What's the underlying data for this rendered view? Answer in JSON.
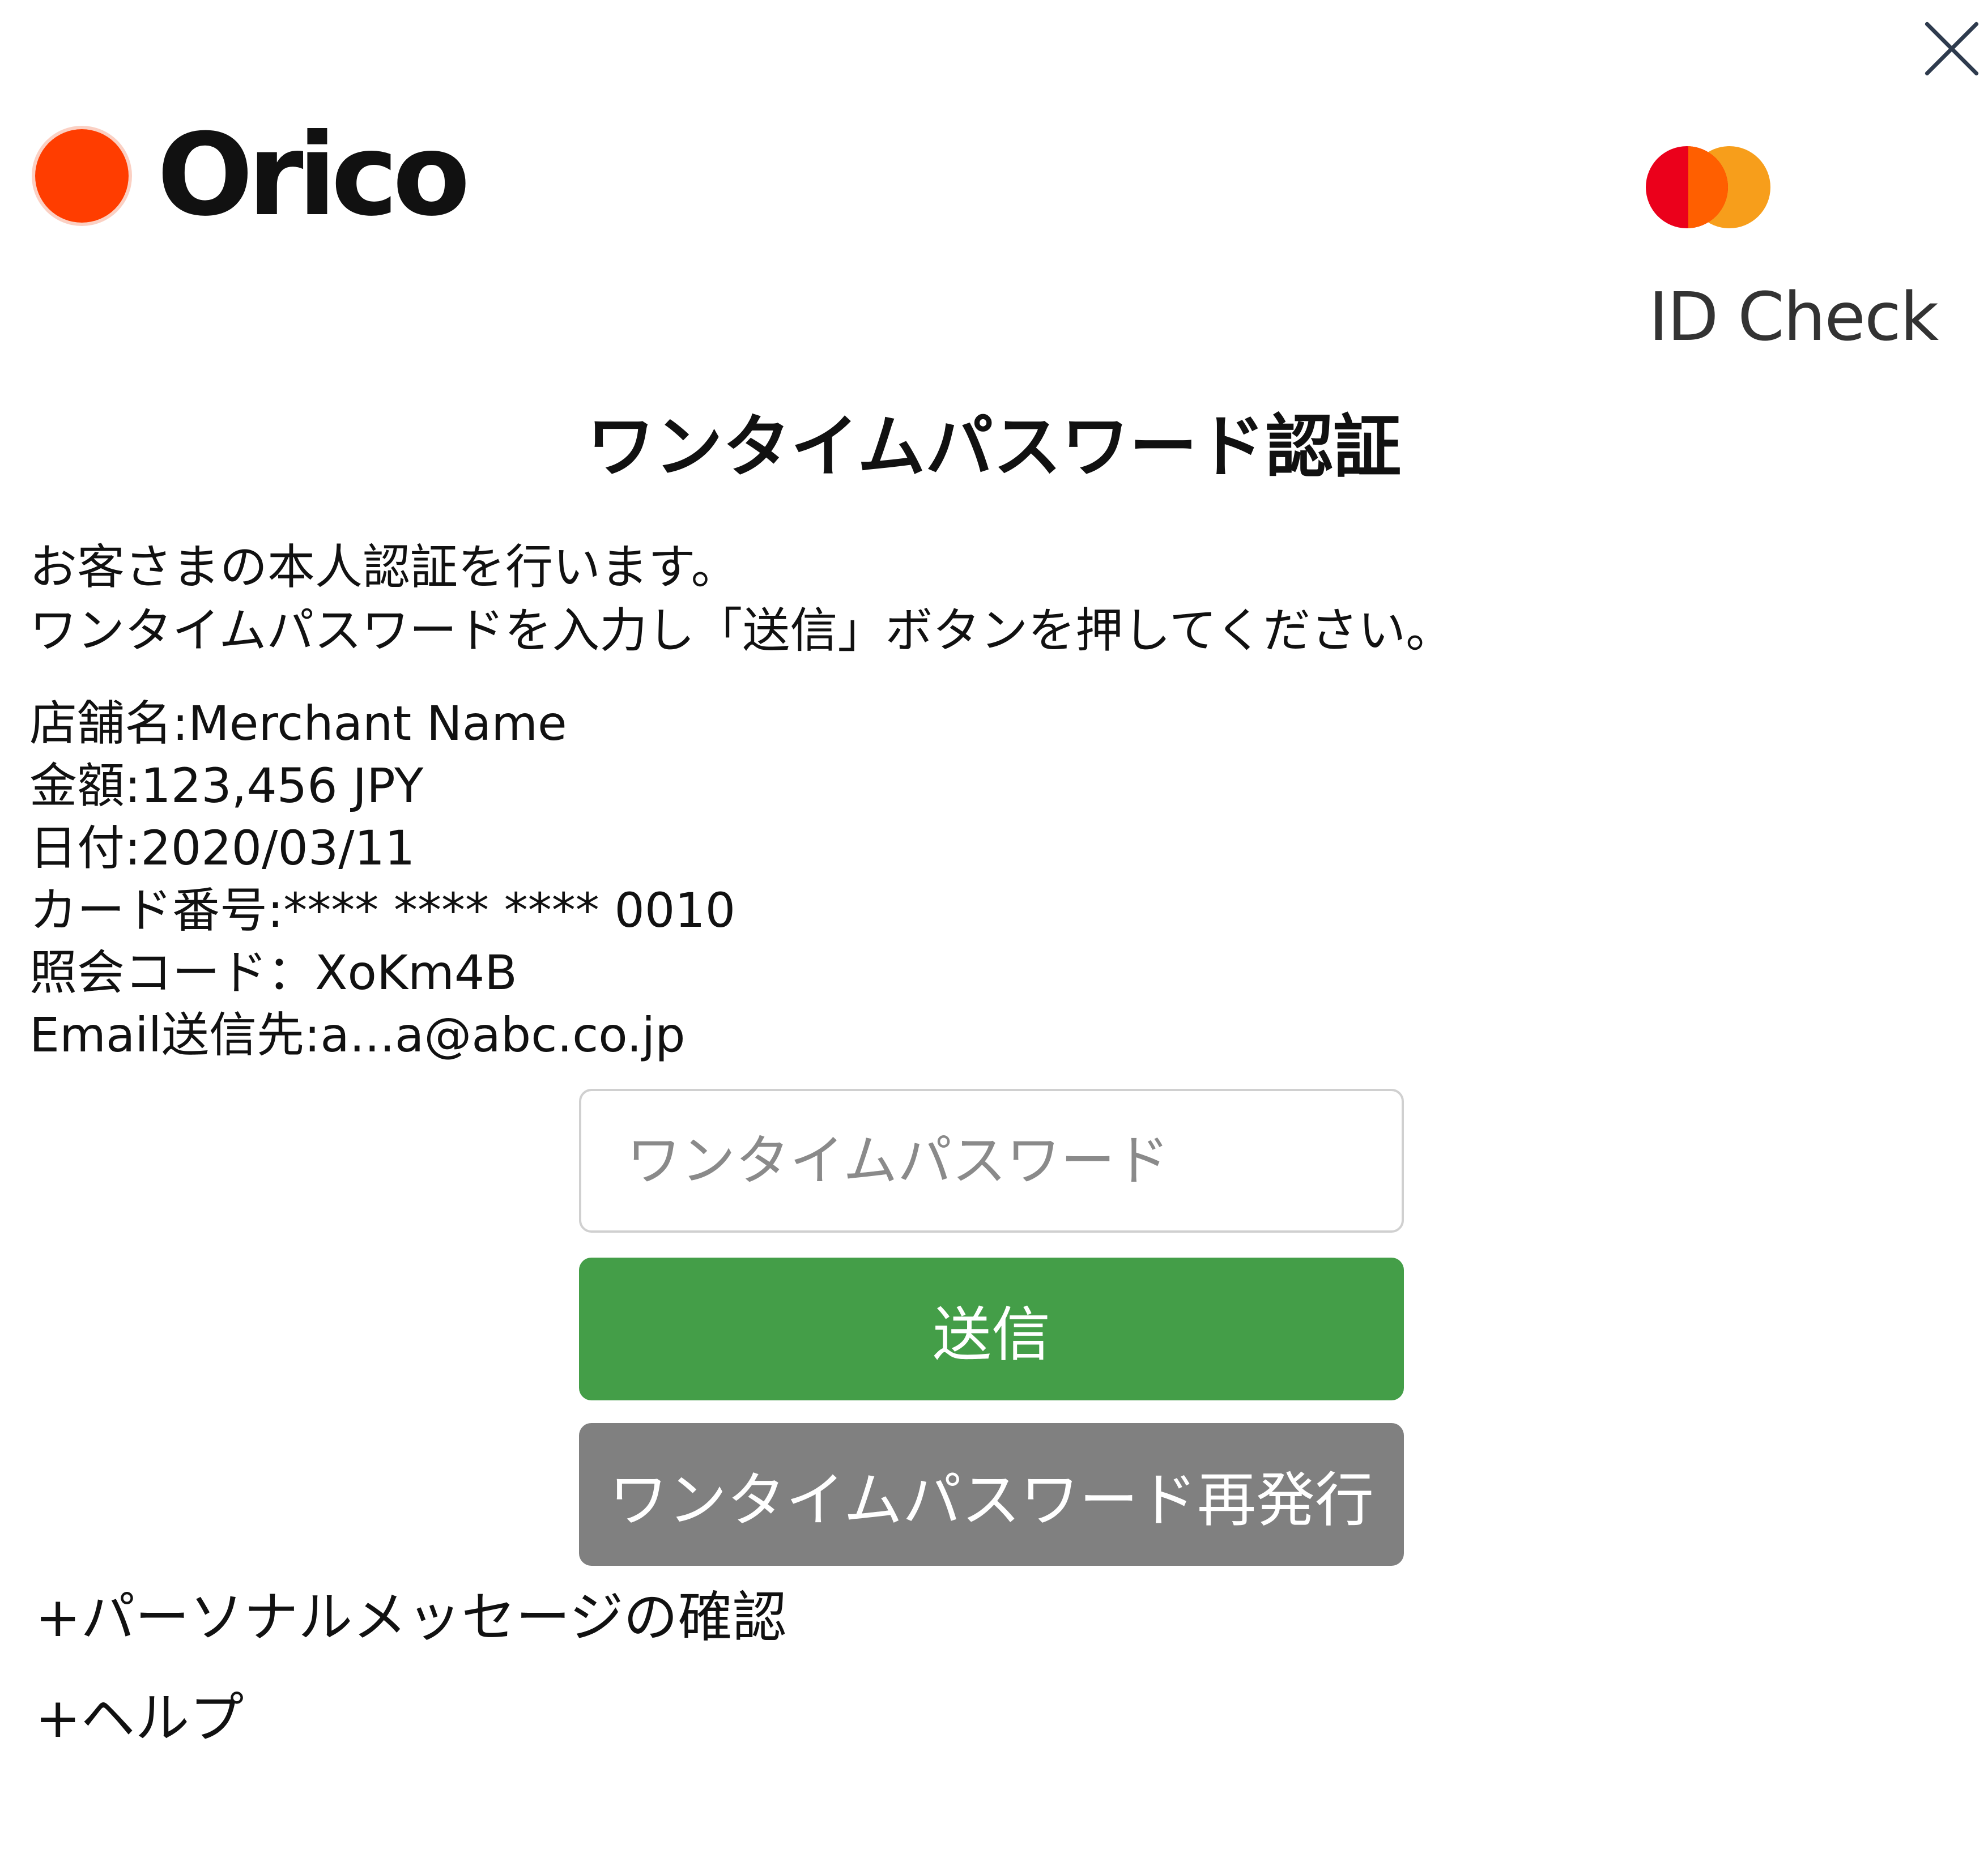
{
  "header": {
    "close_icon": "close-icon",
    "brand_name": "Orico",
    "network_logo": "mastercard-logo",
    "network_label": "ID Check",
    "colors": {
      "orico_red": "#ff3d00",
      "mastercard_red": "#eb001b",
      "mastercard_orange": "#f79e1b"
    }
  },
  "title": "ワンタイムパスワード認証",
  "instructions": {
    "line1": "お客さまの本人認証を行います。",
    "line2": "ワンタイムパスワードを入力し「送信」ボタンを押してください。"
  },
  "info": {
    "merchant": "店舗名:Merchant Name",
    "amount": "金額:123,456 JPY",
    "date": "日付:2020/03/11",
    "card_number": "カード番号:**** **** **** 0010",
    "reference_code": "照会コード：XoKm4B",
    "email": "Email送信先:a...a@abc.co.jp"
  },
  "form": {
    "otp_value": "",
    "otp_placeholder": "ワンタイムパスワード",
    "submit_label": "送信",
    "resend_label": "ワンタイムパスワード再発行",
    "colors": {
      "submit": "#449e48",
      "resend": "#808080"
    }
  },
  "links": {
    "personal_message": "+パーソナルメッセージの確認",
    "help": "+ヘルプ"
  }
}
